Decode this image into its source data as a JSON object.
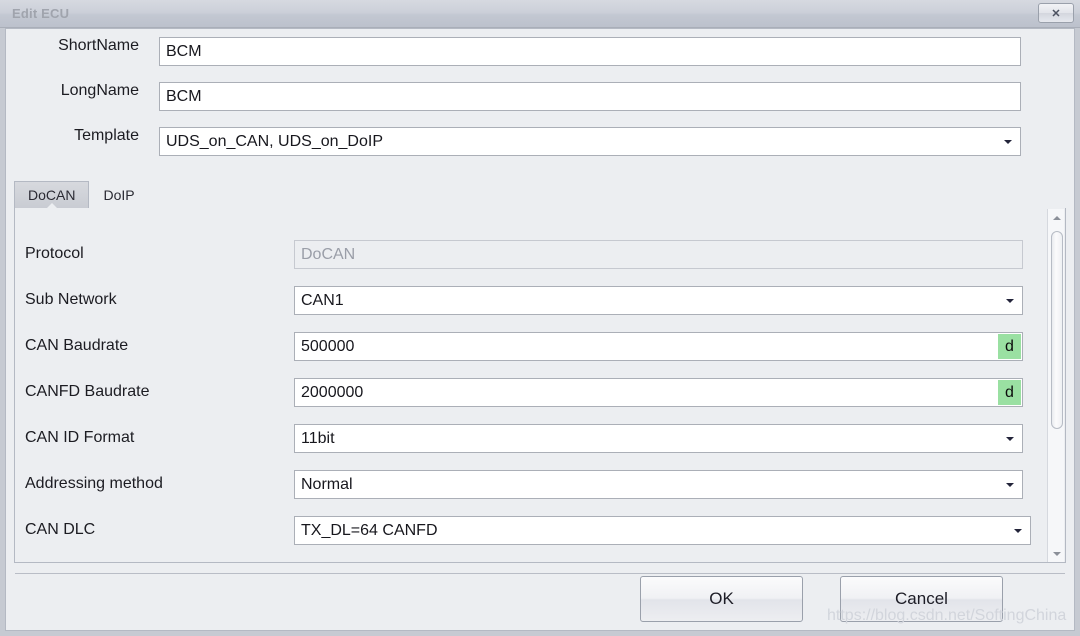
{
  "window": {
    "title": "Edit ECU",
    "close_label": "✕"
  },
  "header_fields": [
    {
      "label": "ShortName",
      "value": "BCM",
      "type": "text"
    },
    {
      "label": "LongName",
      "value": "BCM",
      "type": "text"
    },
    {
      "label": "Template",
      "value": "UDS_on_CAN, UDS_on_DoIP",
      "type": "combo"
    }
  ],
  "tabs": [
    {
      "label": "DoCAN",
      "selected": true
    },
    {
      "label": "DoIP",
      "selected": false
    }
  ],
  "docan_rows": [
    {
      "label": "Protocol",
      "value": "DoCAN",
      "type": "readonly",
      "badge": ""
    },
    {
      "label": "Sub Network",
      "value": "CAN1",
      "type": "combo",
      "badge": ""
    },
    {
      "label": "CAN Baudrate",
      "value": "500000",
      "type": "text",
      "badge": "d"
    },
    {
      "label": "CANFD Baudrate",
      "value": "2000000",
      "type": "text",
      "badge": "d"
    },
    {
      "label": "CAN ID Format",
      "value": "11bit",
      "type": "combo",
      "badge": ""
    },
    {
      "label": "Addressing method",
      "value": "Normal",
      "type": "combo",
      "badge": ""
    },
    {
      "label": "CAN DLC",
      "value": "TX_DL=64 CANFD",
      "type": "combo",
      "badge": ""
    }
  ],
  "scrollbar": {
    "up_icon": "triangle-up",
    "down_icon": "triangle-down"
  },
  "buttons": {
    "ok": "OK",
    "cancel": "Cancel"
  },
  "watermark": "https://blog.csdn.net/SoftingChina",
  "colors": {
    "dialog_background": "#eceef1",
    "field_background": "#ffffff",
    "badge_green": "#9ae0a2",
    "title_text": "#a0a4ad",
    "border": "#b4b9c3"
  }
}
